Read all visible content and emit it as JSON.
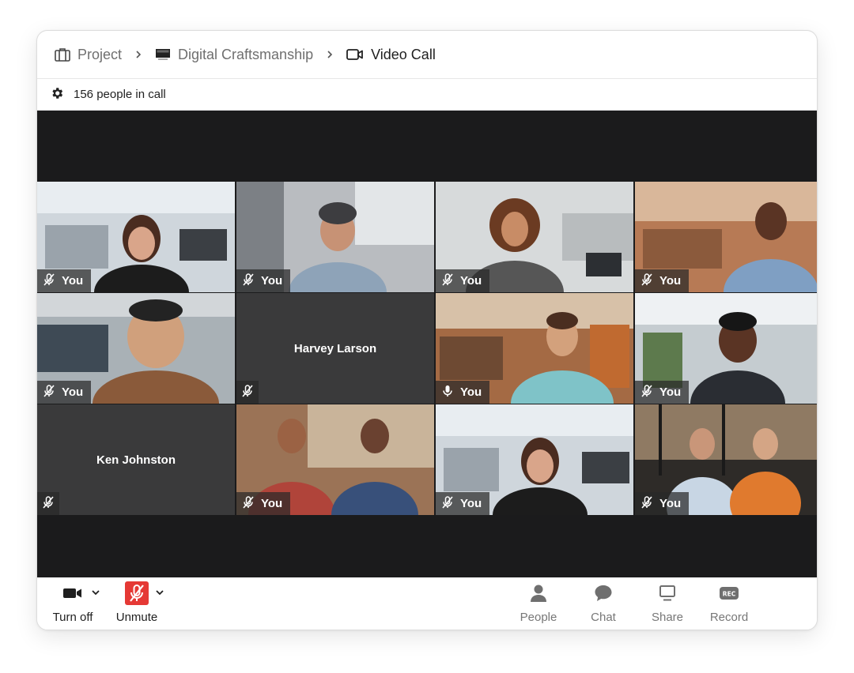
{
  "breadcrumb": {
    "items": [
      {
        "label": "Project",
        "icon": "briefcase-icon"
      },
      {
        "label": "Digital Craftsmanship",
        "icon": "monitor-icon"
      },
      {
        "label": "Video Call",
        "icon": "video-camera-icon"
      }
    ]
  },
  "status": {
    "participants_text": "156 people in call",
    "icon": "gear-icon"
  },
  "tiles": [
    {
      "label": "You",
      "mic": "muted"
    },
    {
      "label": "You",
      "mic": "muted"
    },
    {
      "label": "You",
      "mic": "muted"
    },
    {
      "label": "You",
      "mic": "muted"
    },
    {
      "label": "You",
      "mic": "muted"
    },
    {
      "name": "Harvey Larson",
      "mic": "muted"
    },
    {
      "label": "You",
      "mic": "on",
      "active": true
    },
    {
      "label": "You",
      "mic": "muted"
    },
    {
      "name": "Ken Johnston",
      "mic": "muted"
    },
    {
      "label": "You",
      "mic": "muted"
    },
    {
      "label": "You",
      "mic": "muted"
    },
    {
      "label": "You",
      "mic": "muted"
    }
  ],
  "toolbar": {
    "camera_label": "Turn off",
    "mic_label": "Unmute",
    "people_label": "People",
    "chat_label": "Chat",
    "share_label": "Share",
    "record_label": "Record",
    "record_icon_text": "REC"
  },
  "colors": {
    "stage_bg": "#1b1b1c",
    "active_border": "#2e6fe0",
    "unmute_red": "#e53935"
  }
}
